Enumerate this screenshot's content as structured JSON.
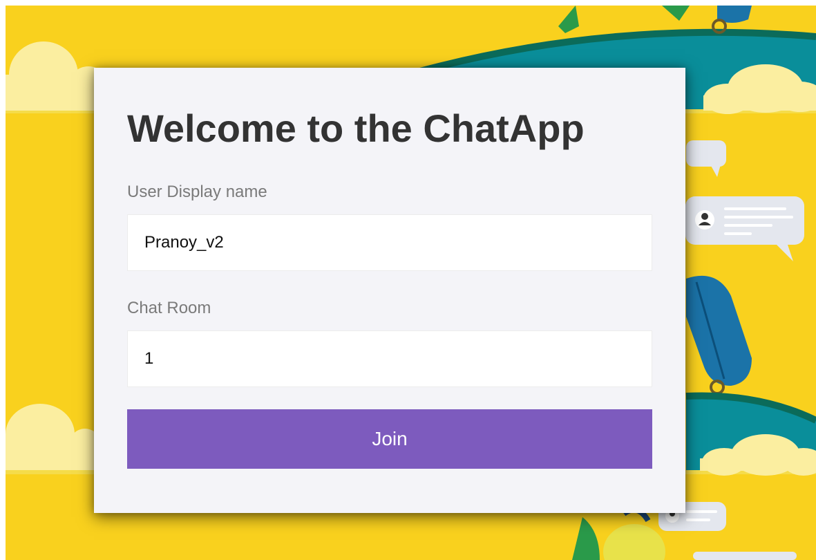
{
  "page": {
    "title": "Welcome to the ChatApp",
    "colors": {
      "background": "#f9d11e",
      "card": "#f4f4f8",
      "button": "#7d5bbe",
      "title": "#333333",
      "label": "#7a7a7a"
    }
  },
  "form": {
    "display_name_label": "User Display name",
    "display_name_value": "Pranoy_v2",
    "room_label": "Chat Room",
    "room_value": "1",
    "join_label": "Join"
  }
}
